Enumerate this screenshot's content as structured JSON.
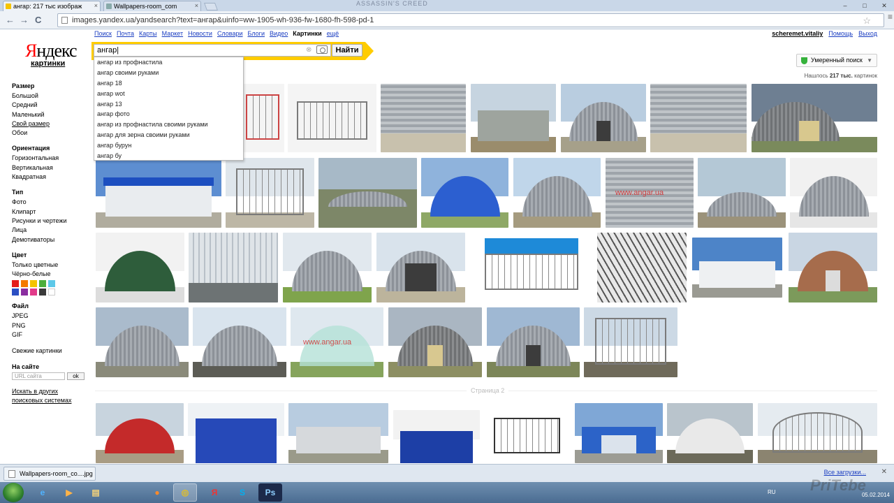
{
  "browser": {
    "tabs": [
      {
        "label": "ангар: 217 тыс изображ"
      },
      {
        "label": "Wallpapers-room_com"
      }
    ],
    "title_watermark": "ASSASSIN'S CREED",
    "address": "images.yandex.ua/yandsearch?text=ангар&uinfo=ww-1905-wh-936-fw-1680-fh-598-pd-1",
    "nav": {
      "back": "←",
      "forward": "→",
      "reload": "C"
    },
    "window_controls": [
      "–",
      "□",
      "✕"
    ]
  },
  "yandex": {
    "logo": "Яндекс",
    "logo_first": "Я",
    "logo_rest": "ндекс",
    "logo_sub": "картинки",
    "services": [
      {
        "label": "Поиск"
      },
      {
        "label": "Почта"
      },
      {
        "label": "Карты"
      },
      {
        "label": "Маркет"
      },
      {
        "label": "Новости"
      },
      {
        "label": "Словари"
      },
      {
        "label": "Блоги"
      },
      {
        "label": "Видео"
      },
      {
        "label": "Картинки",
        "current": true
      },
      {
        "label": "ещё"
      }
    ],
    "user": "scheremet.vitaliy",
    "help": "Помощь",
    "logout": "Выход",
    "search_value": "ангар",
    "find_label": "Найти",
    "suggestions": [
      "ангар из профнастила",
      "ангар своими руками",
      "ангар 18",
      "ангар wot",
      "ангар 13",
      "ангар фото",
      "ангар из профнастила своими руками",
      "ангар для зерна своими руками",
      "ангар бурун",
      "ангар бу"
    ],
    "safe_search": "Умеренный поиск",
    "found_prefix": "Нашлось",
    "found_count": "217 тыс.",
    "found_suffix": "картинок",
    "page2_label": "Страница 2"
  },
  "sidebar": {
    "size": {
      "title": "Размер",
      "items": [
        "Большой",
        "Средний",
        "Маленький",
        "Свой размер",
        "Обои"
      ]
    },
    "orientation": {
      "title": "Ориентация",
      "items": [
        "Горизонтальная",
        "Вертикальная",
        "Квадратная"
      ]
    },
    "type": {
      "title": "Тип",
      "items": [
        "Фото",
        "Клипарт",
        "Рисунки и чертежи",
        "Лица",
        "Демотиваторы"
      ]
    },
    "color": {
      "title": "Цвет",
      "items": [
        "Только цветные",
        "Чёрно-белые"
      ],
      "swatches": [
        "#e41c1c",
        "#f47a00",
        "#f5c400",
        "#4caf3c",
        "#5dc8e8",
        "#2b4fc3",
        "#8b2ea0",
        "#e23b8a",
        "#3a3a3a",
        "#ffffff"
      ]
    },
    "file": {
      "title": "Файл",
      "items": [
        "JPEG",
        "PNG",
        "GIF"
      ]
    },
    "fresh": "Свежие картинки",
    "site": {
      "title": "На сайте",
      "placeholder": "URL сайта",
      "ok": "ok"
    },
    "other_line1": "Искать в других",
    "other_line2": "поисковых системах"
  },
  "downloads": {
    "file": "Wallpapers-room_co....jpg",
    "all": "Все загрузки...",
    "close": "✕"
  },
  "taskbar": {
    "lang": "RU",
    "date": "05.02.2014",
    "apps": [
      "e",
      "▶",
      "▤",
      "●",
      "◎",
      "Я",
      "S",
      "Ps"
    ]
  },
  "corner_watermark": "PriTebe",
  "thumb_captions": {
    "angar1": "www.angar.ua",
    "angar2": "www.angar.ua"
  }
}
